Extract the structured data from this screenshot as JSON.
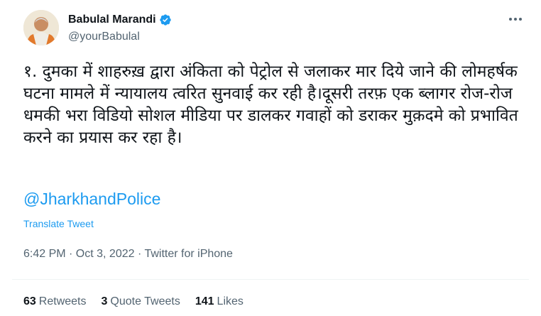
{
  "author": {
    "name": "Babulal Marandi",
    "handle": "@yourBabulal",
    "verified": true
  },
  "tweet": {
    "text": "१. दुमका में शाहरुख़ द्वारा अंकिता को पेट्रोल से जलाकर मार दिये जाने की लोमहर्षक घटना मामले में न्यायालय त्वरित सुनवाई कर रही है।दूसरी तरफ़ एक ब्लागर रोज-रोज धमकी भरा विडियो सोशल मीडिया पर डालकर गवाहों को डराकर मुक़दमे को प्रभावित करने का प्रयास कर रहा है।",
    "mention": "@JharkhandPolice",
    "translate_label": "Translate Tweet",
    "meta": "6:42 PM · Oct 3, 2022 · Twitter for iPhone"
  },
  "stats": {
    "retweets_count": "63",
    "retweets_label": "Retweets",
    "quote_count": "3",
    "quote_label": "Quote Tweets",
    "likes_count": "141",
    "likes_label": "Likes"
  },
  "colors": {
    "link": "#1d9bf0",
    "secondary_text": "#536471",
    "primary_text": "#0f1419"
  },
  "icons": {
    "verified": "verified-badge-icon",
    "more": "more-options-icon"
  }
}
